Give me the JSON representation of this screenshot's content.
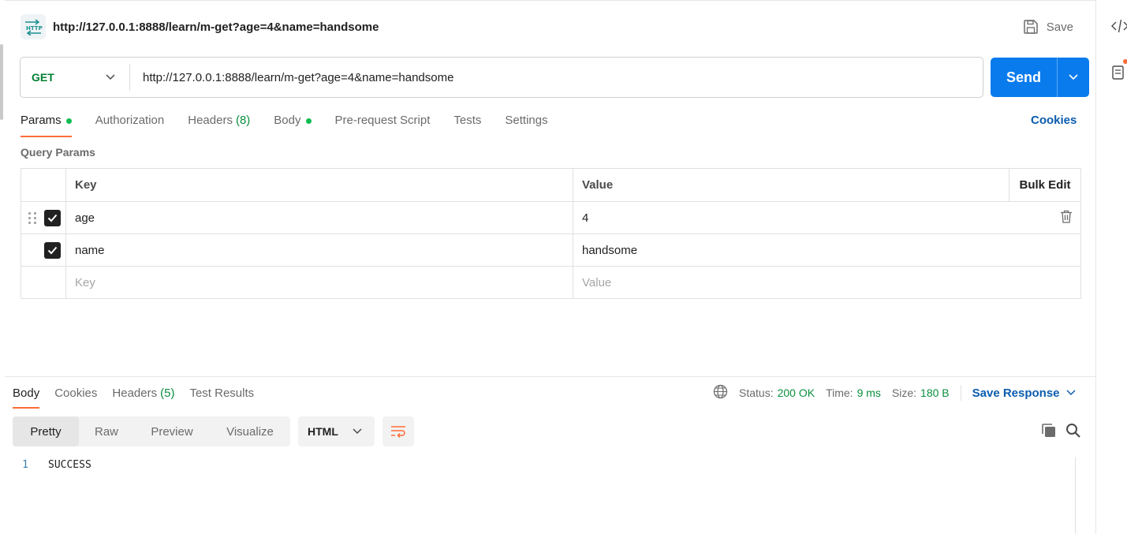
{
  "request": {
    "badge": "HTTP",
    "title": "http://127.0.0.1:8888/learn/m-get?age=4&name=handsome",
    "save_label": "Save",
    "method": "GET",
    "url": "http://127.0.0.1:8888/learn/m-get?age=4&name=handsome",
    "send_label": "Send"
  },
  "request_tabs": {
    "params": "Params",
    "authorization": "Authorization",
    "headers": "Headers",
    "headers_count": "(8)",
    "body": "Body",
    "prerequest": "Pre-request Script",
    "tests": "Tests",
    "settings": "Settings",
    "cookies": "Cookies"
  },
  "query_params": {
    "title": "Query Params",
    "key_header": "Key",
    "value_header": "Value",
    "bulk_edit": "Bulk Edit",
    "rows": [
      {
        "key": "age",
        "value": "4",
        "checked": true
      },
      {
        "key": "name",
        "value": "handsome",
        "checked": true
      }
    ],
    "key_placeholder": "Key",
    "value_placeholder": "Value"
  },
  "response": {
    "tabs": {
      "body": "Body",
      "cookies": "Cookies",
      "headers": "Headers",
      "headers_count": "(5)",
      "test_results": "Test Results"
    },
    "status_label": "Status:",
    "status_value": "200 OK",
    "time_label": "Time:",
    "time_value": "9 ms",
    "size_label": "Size:",
    "size_value": "180 B",
    "save_response": "Save Response",
    "views": [
      "Pretty",
      "Raw",
      "Preview",
      "Visualize"
    ],
    "format": "HTML",
    "lines": [
      {
        "number": "1",
        "text": "SUCCESS"
      }
    ]
  },
  "colors": {
    "accent_orange": "#ff6c37",
    "send_blue": "#097bed",
    "link_blue": "#0b5cad",
    "status_green": "#0a8f3e",
    "method_green": "#007f31"
  }
}
